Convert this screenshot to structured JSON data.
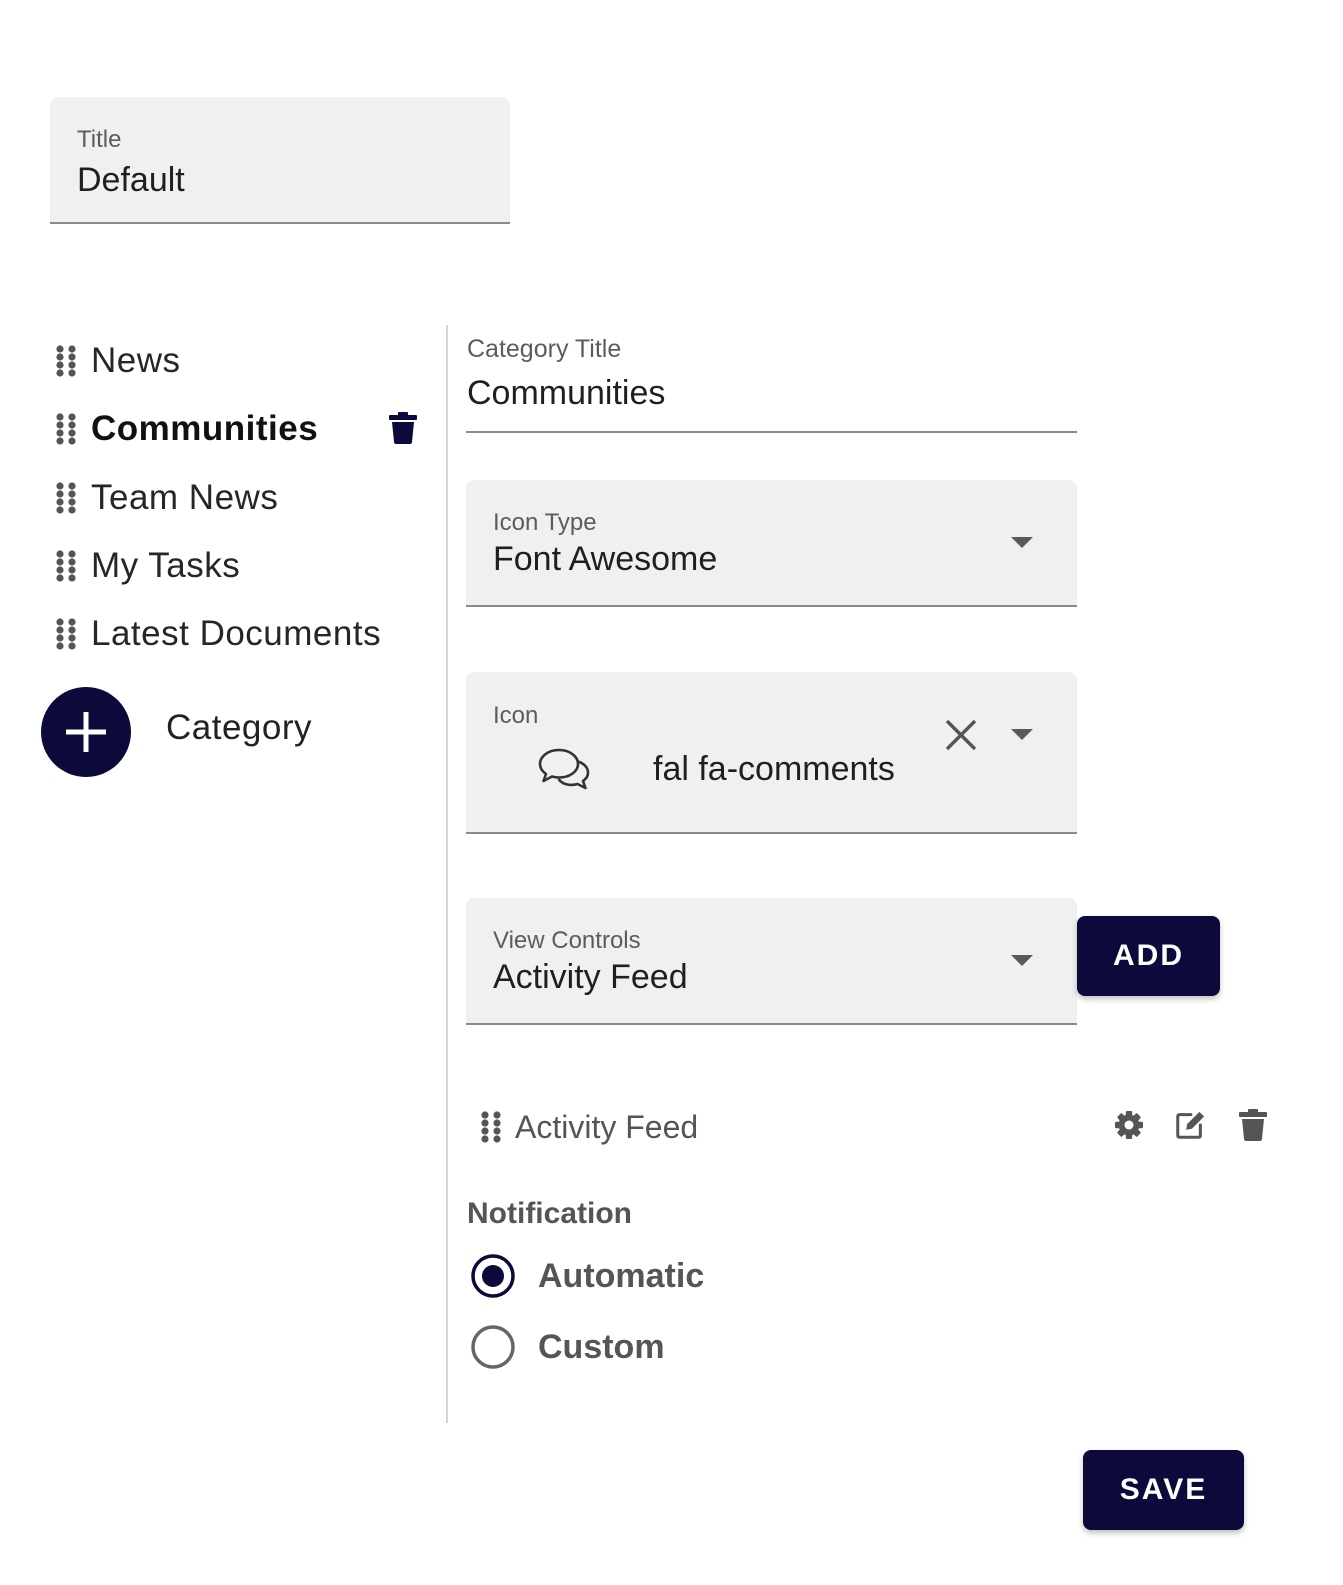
{
  "title_field": {
    "label": "Title",
    "value": "Default"
  },
  "categories": [
    {
      "label": "News"
    },
    {
      "label": "Communities"
    },
    {
      "label": "Team News"
    },
    {
      "label": "My Tasks"
    },
    {
      "label": "Latest Documents"
    }
  ],
  "add_category": {
    "label": "Category"
  },
  "category_title": {
    "label": "Category Title",
    "value": "Communities"
  },
  "icon_type": {
    "label": "Icon Type",
    "value": "Font Awesome"
  },
  "icon": {
    "label": "Icon",
    "value": "fal fa-comments",
    "glyph": "comments-icon"
  },
  "view_controls": {
    "label": "View Controls",
    "value": "Activity Feed",
    "add_label": "ADD"
  },
  "view_list": [
    {
      "label": "Activity Feed"
    }
  ],
  "notification": {
    "label": "Notification",
    "options": [
      {
        "label": "Automatic",
        "selected": true
      },
      {
        "label": "Custom",
        "selected": false
      }
    ]
  },
  "save_label": "SAVE",
  "colors": {
    "primary": "#0b0a3a",
    "field_bg": "#f0f0f0"
  }
}
